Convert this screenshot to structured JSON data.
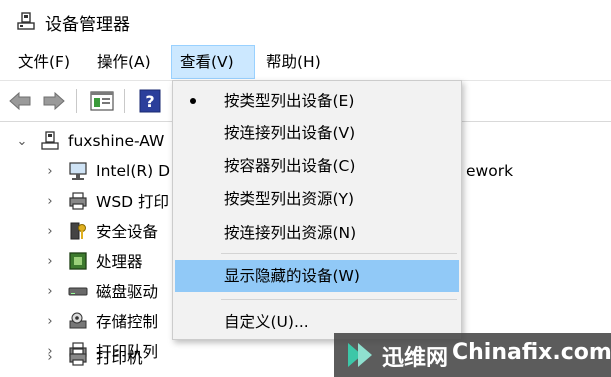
{
  "window": {
    "title": "设备管理器"
  },
  "menubar": {
    "items": [
      {
        "label": "文件(F)"
      },
      {
        "label": "操作(A)"
      },
      {
        "label": "查看(V)"
      },
      {
        "label": "帮助(H)"
      }
    ]
  },
  "toolbar": {
    "buttons": [
      "back-arrow-icon",
      "forward-arrow-icon",
      "properties-icon",
      "help-icon"
    ]
  },
  "tree": {
    "root": "fuxshine-AW",
    "partial_text": "ework",
    "children": [
      {
        "label": "Intel(R) D",
        "icon": "network-adapter-icon"
      },
      {
        "label": "WSD 打印",
        "icon": "printer-icon"
      },
      {
        "label": "安全设备",
        "icon": "security-key-icon"
      },
      {
        "label": "处理器",
        "icon": "processor-icon"
      },
      {
        "label": "磁盘驱动",
        "icon": "disk-drive-icon"
      },
      {
        "label": "存储控制",
        "icon": "storage-controller-icon"
      },
      {
        "label": "打印队列",
        "icon": "printer-icon"
      },
      {
        "label": "打印机",
        "icon": "printer-icon"
      }
    ]
  },
  "view_menu": {
    "items": [
      {
        "label": "按类型列出设备(E)",
        "checked": true
      },
      {
        "label": "按连接列出设备(V)"
      },
      {
        "label": "按容器列出设备(C)"
      },
      {
        "label": "按类型列出资源(Y)"
      },
      {
        "label": "按连接列出资源(N)"
      },
      {
        "label": "显示隐藏的设备(W)",
        "highlighted": true
      },
      {
        "label": "自定义(U)..."
      }
    ]
  },
  "watermark": {
    "cn": "迅维网",
    "en": "Chinafix.com"
  },
  "colors": {
    "menu_active": "#cce8ff",
    "menu_highlight": "#91c9f7",
    "dropdown_bg": "#f2f2f2"
  }
}
